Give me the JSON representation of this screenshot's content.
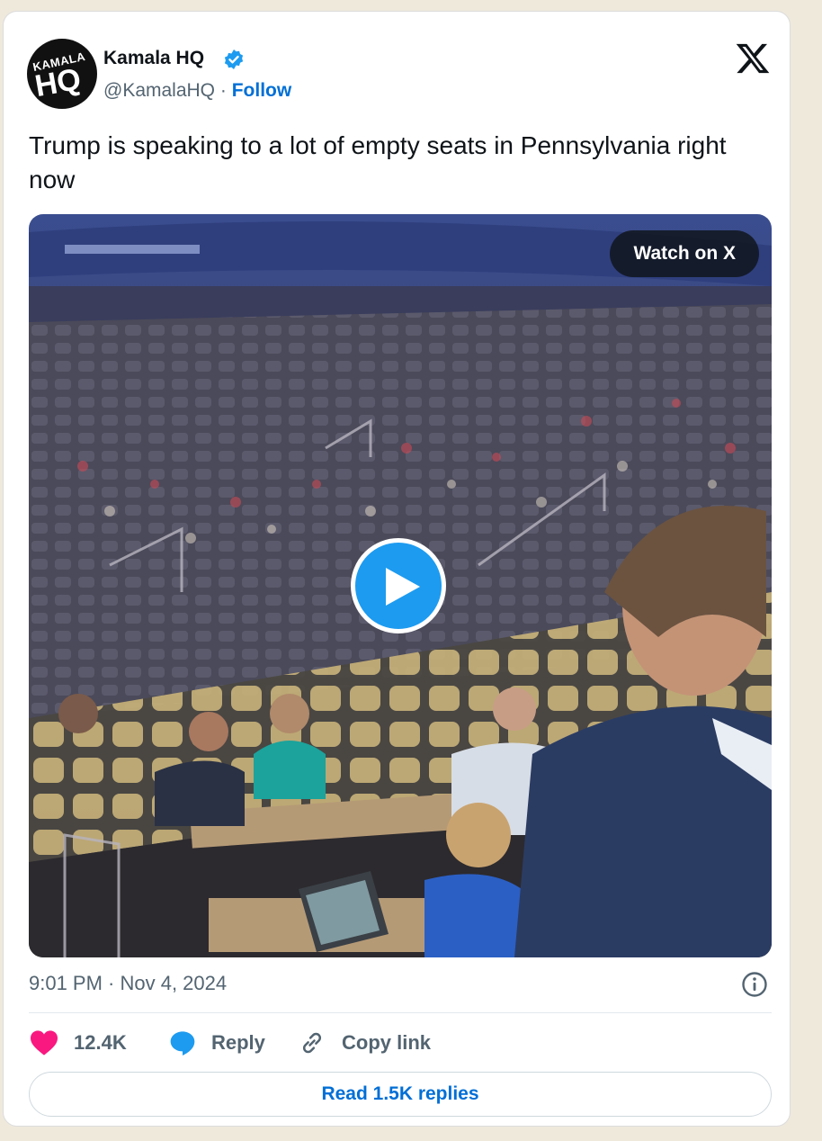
{
  "author": {
    "avatar_top_text": "KAMALA",
    "avatar_main_text": "HQ",
    "name": "Kamala HQ",
    "handle": "@KamalaHQ",
    "separator": "·",
    "follow_label": "Follow"
  },
  "tweet": {
    "text": "Trump is speaking to a lot of empty seats in Pennsylvania right now",
    "timestamp": "9:01 PM · Nov 4, 2024"
  },
  "media": {
    "watch_label": "Watch on X"
  },
  "actions": {
    "likes": "12.4K",
    "reply_label": "Reply",
    "copy_label": "Copy link"
  },
  "footer": {
    "read_replies_label": "Read 1.5K replies"
  },
  "colors": {
    "brand_blue": "#1d9bf0",
    "link_blue": "#006fd6",
    "like_pink": "#f91880"
  }
}
